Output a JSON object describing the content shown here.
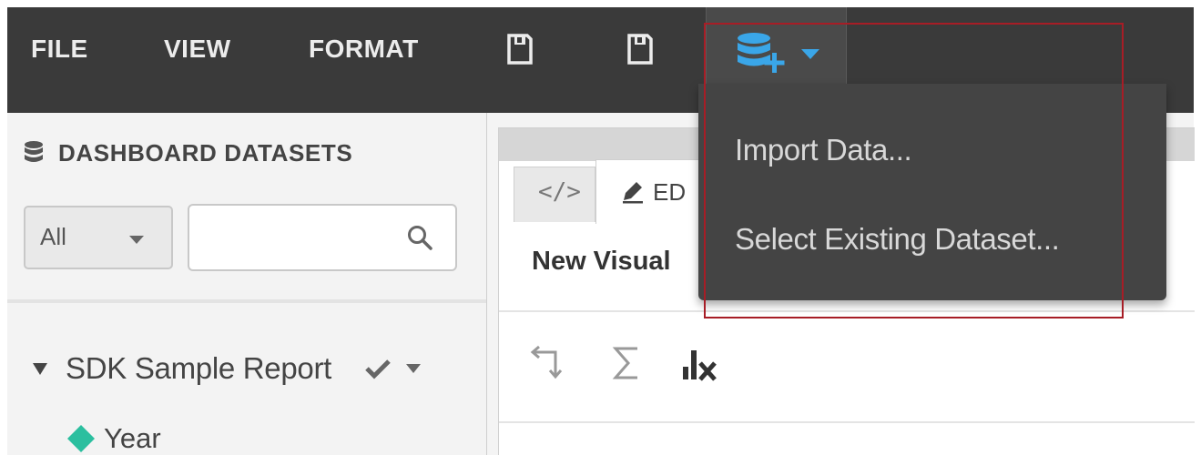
{
  "menubar": {
    "items": [
      "FILE",
      "VIEW",
      "FORMAT"
    ],
    "save_icon": "floppy-disk-icon",
    "save_as_icon": "floppy-disk-icon",
    "add_dataset_icon": "database-add-icon",
    "accent": "#3aa6e8",
    "background": "#3a3a3a"
  },
  "dropdown": {
    "items": [
      "Import Data...",
      "Select Existing Dataset..."
    ],
    "highlight_color": "#a71d26"
  },
  "left_panel": {
    "header_icon": "database-icon",
    "title": "DASHBOARD DATASETS",
    "filter": {
      "selected": "All"
    },
    "search": {
      "value": "",
      "placeholder": "",
      "icon": "search-icon"
    },
    "tree": {
      "dataset": {
        "label": "SDK Sample Report",
        "status_icon": "checkmark-icon"
      },
      "fields": [
        {
          "label": "Year",
          "icon": "diamond-icon",
          "color": "#2bbf9f"
        }
      ]
    }
  },
  "editor": {
    "tabs": [
      {
        "icon": "code-icon",
        "label": ""
      },
      {
        "icon": "pencil-icon",
        "label": "ED"
      }
    ],
    "visual_title": "New Visual",
    "toolbar_icons": [
      "swap-axes-icon",
      "sigma-icon",
      "clear-chart-icon"
    ]
  }
}
